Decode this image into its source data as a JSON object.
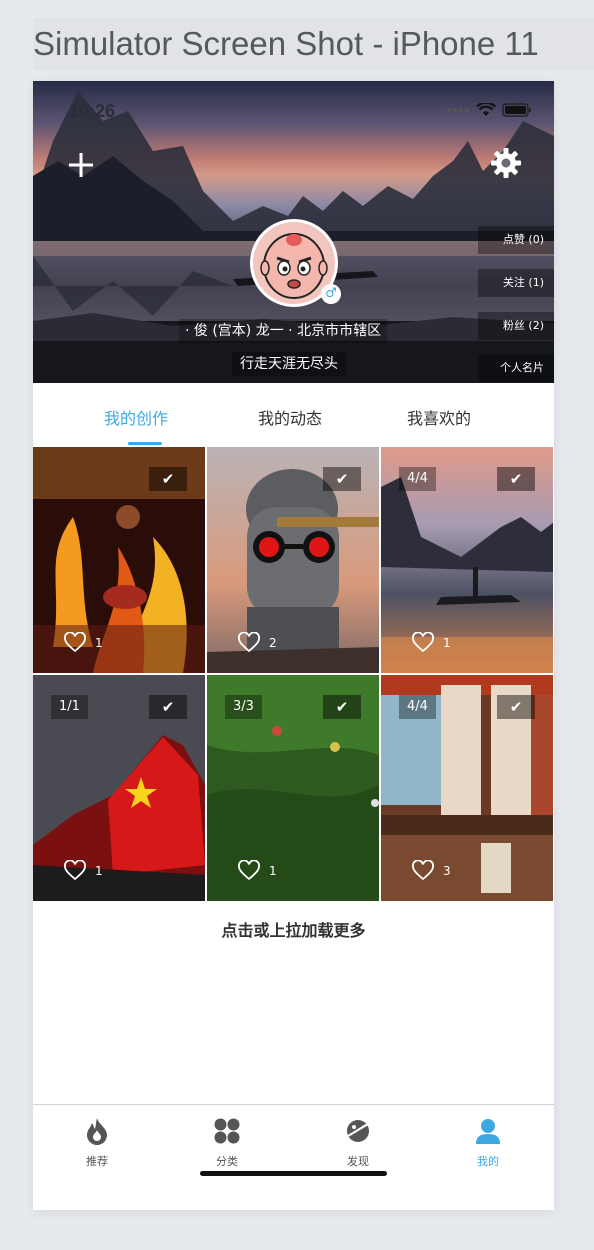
{
  "window": {
    "title": "Simulator Screen Shot - iPhone 11"
  },
  "status_bar": {
    "time": "10:26"
  },
  "header": {
    "plus_icon": "plus-icon",
    "settings_icon": "gear-icon",
    "user_info": "· 俊 (宫本) 龙一 · 北京市市辖区",
    "signature": "行走天涯无尽头",
    "gender_symbol": "♂",
    "side_buttons": [
      {
        "label": "点赞 (0)"
      },
      {
        "label": "关注 (1)"
      },
      {
        "label": "粉丝 (2)"
      },
      {
        "label": "个人名片"
      }
    ]
  },
  "tabs": [
    {
      "label": "我的创作",
      "active": true
    },
    {
      "label": "我的动态",
      "active": false
    },
    {
      "label": "我喜欢的",
      "active": false
    }
  ],
  "grid": [
    {
      "count": "",
      "check": "✔",
      "likes": "1",
      "subject": "fire dancer"
    },
    {
      "count": "",
      "check": "✔",
      "likes": "2",
      "subject": "buddha statue with goggles"
    },
    {
      "count": "4/4",
      "check": "✔",
      "likes": "1",
      "subject": "river landscape with fisherman"
    },
    {
      "count": "1/1",
      "check": "✔",
      "likes": "1",
      "subject": "mountain with red flag"
    },
    {
      "count": "3/3",
      "check": "✔",
      "likes": "1",
      "subject": "green hillside"
    },
    {
      "count": "4/4",
      "check": "✔",
      "likes": "3",
      "subject": "restaurant interior"
    }
  ],
  "load_more": "点击或上拉加载更多",
  "tab_bar": [
    {
      "label": "推荐",
      "icon": "flame-icon",
      "active": false
    },
    {
      "label": "分类",
      "icon": "grid-icon",
      "active": false
    },
    {
      "label": "发现",
      "icon": "planet-icon",
      "active": false
    },
    {
      "label": "我的",
      "icon": "person-icon",
      "active": true
    }
  ],
  "colors": {
    "accent": "#3da9e3",
    "text": "#333333",
    "separator": "#cfd2d6"
  }
}
